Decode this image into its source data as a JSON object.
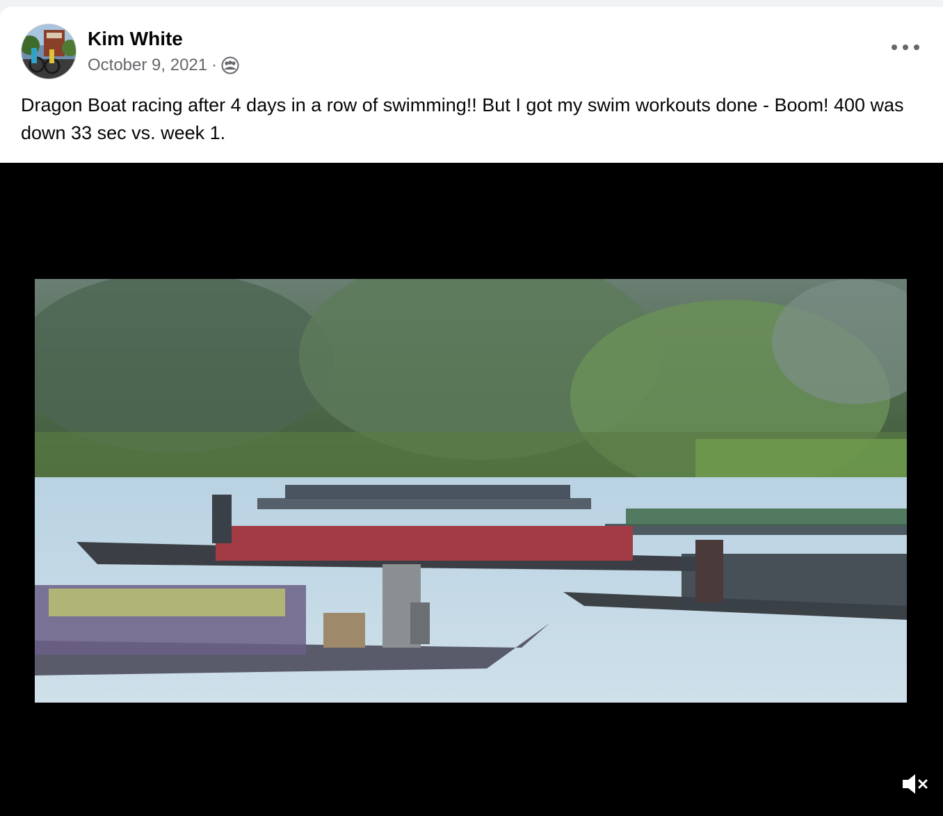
{
  "post": {
    "author": "Kim White",
    "date": "October 9, 2021",
    "separator": "·",
    "audience_icon": "friends-icon",
    "more_icon": "more-options-icon",
    "text": "Dragon Boat racing after 4 days in a row of swimming!! But I got my swim workouts done - Boom! 400 was down 33 sec vs. week 1."
  },
  "video": {
    "mute_icon": "volume-muted-icon"
  }
}
